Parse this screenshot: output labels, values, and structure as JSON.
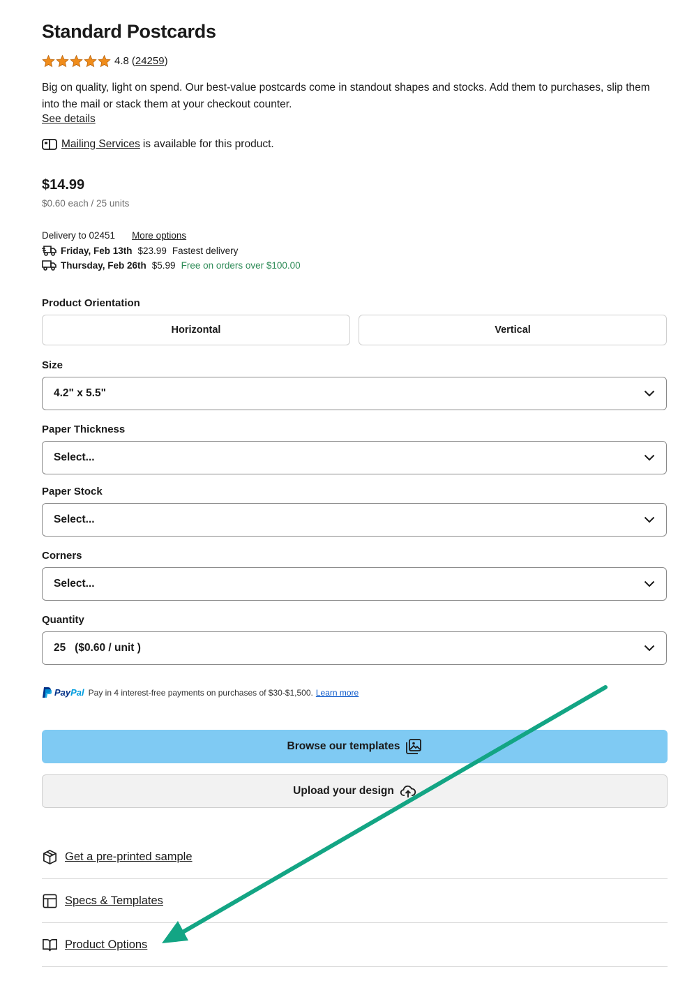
{
  "product": {
    "title": "Standard Postcards",
    "rating": "4.8",
    "reviews_open": "(",
    "reviews_count": "24259",
    "reviews_close": ")",
    "description": "Big on quality, light on spend. Our best-value postcards come in standout shapes and stocks. Add them to purchases, slip them into the mail or stack them at your checkout counter.",
    "see_details": "See details",
    "mailing_link": "Mailing Services",
    "mailing_text": "is available for this product.",
    "price": "$14.99",
    "unit_price": "$0.60 each / 25 units"
  },
  "delivery": {
    "label": "Delivery to 02451",
    "more_options": "More options",
    "options": [
      {
        "date": "Friday, Feb 13th",
        "fee": "$23.99",
        "note": "Fastest delivery"
      },
      {
        "date": "Thursday, Feb 26th",
        "fee": "$5.99",
        "note": "Free on orders over $100.00"
      }
    ]
  },
  "options": {
    "orientation_label": "Product Orientation",
    "orientation_choices": [
      "Horizontal",
      "Vertical"
    ],
    "size_label": "Size",
    "size_value": "4.2\" x 5.5\"",
    "thickness_label": "Paper Thickness",
    "thickness_value": "Select...",
    "stock_label": "Paper Stock",
    "stock_value": "Select...",
    "corners_label": "Corners",
    "corners_value": "Select...",
    "quantity_label": "Quantity",
    "quantity_value": "25   ($0.60 / unit )"
  },
  "paypal": {
    "brand_pay": "Pay",
    "brand_pal": "Pal",
    "text": "Pay in 4 interest-free payments on purchases of $30-$1,500.",
    "learn_more": "Learn more"
  },
  "actions": {
    "browse_templates": "Browse our templates",
    "upload_design": "Upload your design"
  },
  "links": {
    "sample": "Get a pre-printed sample",
    "specs": "Specs & Templates",
    "product_options": "Product Options"
  },
  "colors": {
    "primary_button": "#7fcaf3",
    "star": "#f08c1a",
    "free_delivery": "#2e8b57",
    "annotation_arrow": "#13a584"
  }
}
